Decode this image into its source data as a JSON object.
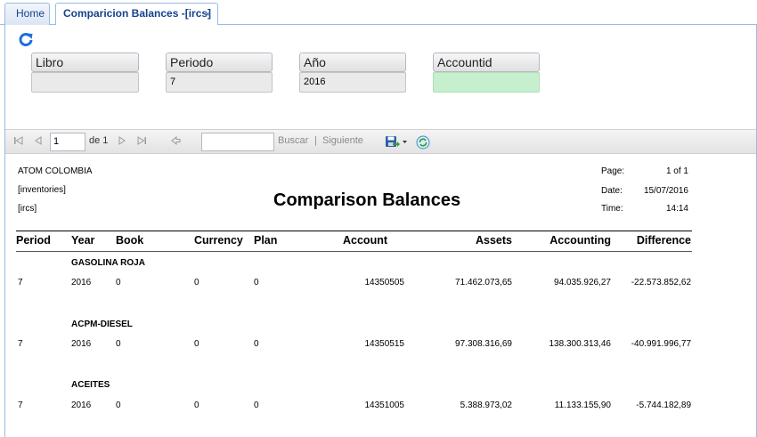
{
  "tabs": {
    "home": "Home",
    "active": "Comparicion Balances -[ircs]",
    "close": "×"
  },
  "filters": {
    "libro": {
      "label": "Libro",
      "value": ""
    },
    "periodo": {
      "label": "Periodo",
      "value": "7"
    },
    "anio": {
      "label": "Año",
      "value": "2016"
    },
    "accountid": {
      "label": "Accountid",
      "value": ""
    }
  },
  "toolbar": {
    "page": "1",
    "of_label": "de 1",
    "search_value": "",
    "buscar": "Buscar",
    "separator": "|",
    "siguiente": "Siguiente"
  },
  "report": {
    "company": "ATOM COLOMBIA",
    "line2": "[inventories]",
    "line3": "[ircs]",
    "title": "Comparison Balances",
    "page_label": "Page:",
    "page_value": "1 of 1",
    "date_label": "Date:",
    "date_value": "15/07/2016",
    "time_label": "Time:",
    "time_value": "14:14",
    "columns": [
      "Period",
      "Year",
      "Book",
      "Currency",
      "Plan",
      "Account",
      "Assets",
      "Accounting",
      "Difference"
    ],
    "groups": [
      {
        "name": "GASOLINA ROJA",
        "period": "7",
        "year": "2016",
        "book": "0",
        "currency": "0",
        "plan": "0",
        "account": "14350505",
        "assets": "71.462.073,65",
        "accounting": "94.035.926,27",
        "difference": "-22.573.852,62"
      },
      {
        "name": "ACPM-DIESEL",
        "period": "7",
        "year": "2016",
        "book": "0",
        "currency": "0",
        "plan": "0",
        "account": "14350515",
        "assets": "97.308.316,69",
        "accounting": "138.300.313,46",
        "difference": "-40.991.996,77"
      },
      {
        "name": "ACEITES",
        "period": "7",
        "year": "2016",
        "book": "0",
        "currency": "0",
        "plan": "0",
        "account": "14351005",
        "assets": "5.388.973,02",
        "accounting": "11.133.155,90",
        "difference": "-5.744.182,89"
      }
    ]
  },
  "colors": {
    "tab_text": "#15428b",
    "border": "#99bbe8",
    "accountid_bg": "#c6efce",
    "refresh": "#1e6fd9"
  }
}
